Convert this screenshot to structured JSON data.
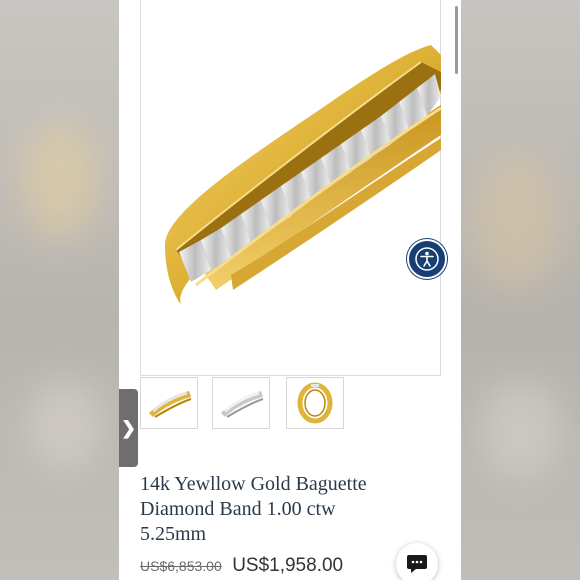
{
  "product": {
    "title_line1": "14k Yewllow Gold Baguette",
    "title_line2": "Diamond Band 1.00 ctw",
    "title_line3": "5.25mm",
    "original_price": "US$6,853.00",
    "sale_price": "US$1,958.00"
  },
  "main_image": {
    "icon": "gold-baguette-ring-image"
  },
  "thumbnails": [
    {
      "name": "thumbnail-yellow-gold-ring",
      "icon": "yellow-gold-band"
    },
    {
      "name": "thumbnail-white-gold-ring",
      "icon": "white-gold-band"
    },
    {
      "name": "thumbnail-ring-front-view",
      "icon": "ring-front-view"
    }
  ],
  "side_tab": {
    "glyph": "❯"
  },
  "accessibility": {
    "icon": "accessibility-icon"
  },
  "chat": {
    "icon": "chat-bubble-icon"
  },
  "colors": {
    "gold": "#e0b43a",
    "gold_dark": "#b8860b",
    "accessibility_blue": "#173f73",
    "title_text": "#2b3a4a"
  }
}
